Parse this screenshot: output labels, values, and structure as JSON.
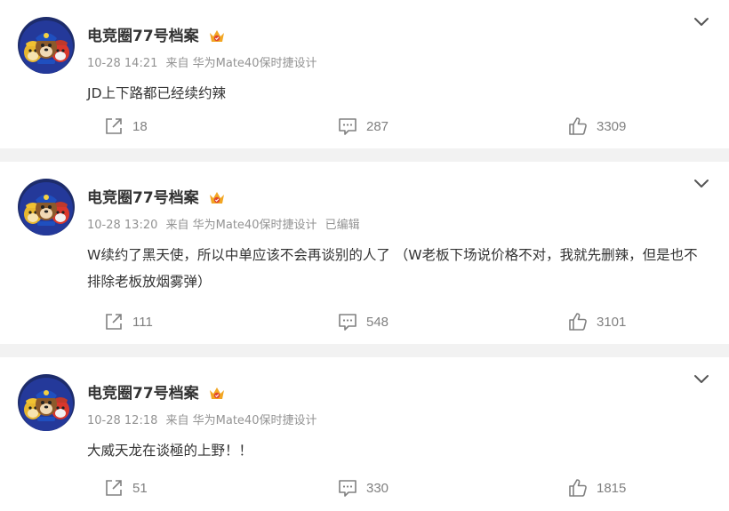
{
  "posts": [
    {
      "user": {
        "name": "电竞圈77号档案",
        "avatar": "paw-patrol-avatar",
        "badge": "vip-crown-icon",
        "badge_color": "#f2a623"
      },
      "time": "10-28 14:21",
      "source": "来自 华为Mate40保时捷设计",
      "edited": "",
      "content": "JD上下路都已经续约辣",
      "actions": {
        "repost": "18",
        "comment": "287",
        "like": "3309"
      }
    },
    {
      "user": {
        "name": "电竞圈77号档案",
        "avatar": "paw-patrol-avatar",
        "badge": "vip-crown-icon",
        "badge_color": "#f2a623"
      },
      "time": "10-28 13:20",
      "source": "来自 华为Mate40保时捷设计",
      "edited": "已编辑",
      "content": "W续约了黑天使，所以中单应该不会再谈别的人了 （W老板下场说价格不对，我就先删辣，但是也不排除老板放烟雾弹）",
      "actions": {
        "repost": "111",
        "comment": "548",
        "like": "3101"
      }
    },
    {
      "user": {
        "name": "电竞圈77号档案",
        "avatar": "paw-patrol-avatar",
        "badge": "vip-crown-icon",
        "badge_color": "#f2a623"
      },
      "time": "10-28 12:18",
      "source": "来自 华为Mate40保时捷设计",
      "edited": "",
      "content": "大威天龙在谈極的上野！！",
      "actions": {
        "repost": "51",
        "comment": "330",
        "like": "1815"
      }
    }
  ],
  "icons": {
    "more": "chevron-down-icon",
    "repost": "repost-icon",
    "comment": "comment-icon",
    "like": "thumbs-up-icon"
  },
  "colors": {
    "page_bg": "#f2f2f2",
    "card_bg": "#ffffff",
    "text_primary": "#333333",
    "text_meta": "#939393",
    "icon_gray": "#808080"
  }
}
